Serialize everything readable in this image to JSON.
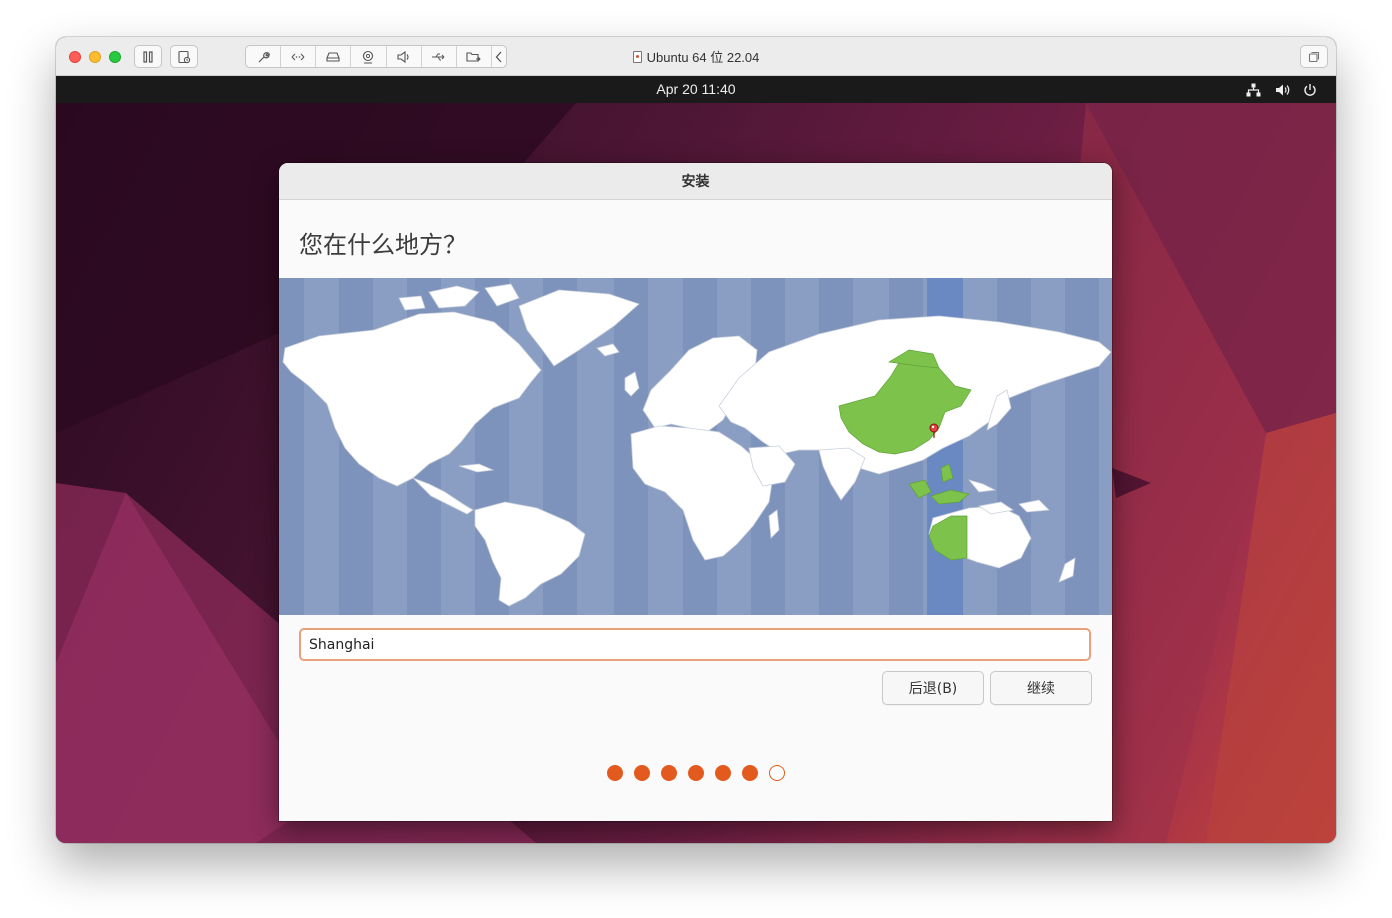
{
  "vm_window": {
    "title": "Ubuntu 64 位 22.04",
    "toolbar_icons": [
      "pause-icon",
      "snapshot-icon",
      "wrench-icon",
      "network-arrows-icon",
      "hard-disk-icon",
      "camera-icon",
      "speaker-icon",
      "usb-icon",
      "shared-folder-icon",
      "chevron-left-icon",
      "fullscreen-icon"
    ]
  },
  "ubuntu_topbar": {
    "clock": "Apr 20  11:40",
    "tray_icons": [
      "network-icon",
      "volume-icon",
      "power-icon"
    ]
  },
  "installer": {
    "window_title": "安装",
    "heading": "您在什么地方？",
    "location_value": "Shanghai",
    "selected_timezone": "Asia/Shanghai",
    "highlight_color": "#7dc24b",
    "back_label": "后退(B)",
    "continue_label": "继续",
    "progress": {
      "total_steps": 7,
      "completed_steps": 6
    },
    "accent_color": "#e35a1f"
  }
}
